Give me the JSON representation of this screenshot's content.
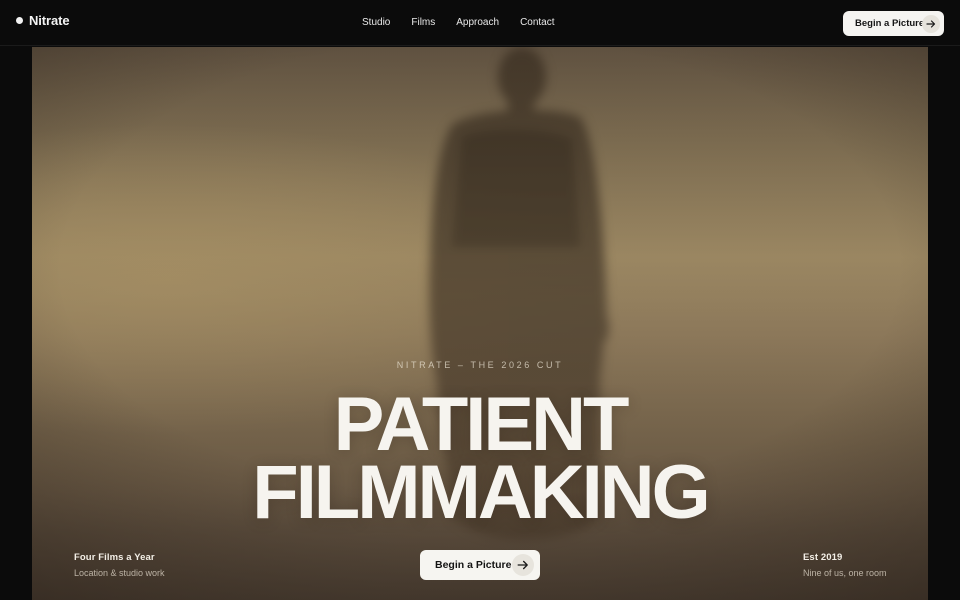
{
  "brand": {
    "name": "Nitrate",
    "dot_icon": "circle-dot-icon"
  },
  "nav": {
    "items": [
      {
        "label": "Studio"
      },
      {
        "label": "Films"
      },
      {
        "label": "Approach"
      },
      {
        "label": "Contact"
      }
    ]
  },
  "header_cta": {
    "label": "Begin a Picture",
    "icon": "arrow-right-icon"
  },
  "hero": {
    "eyebrow": "NITRATE – THE 2026 CUT",
    "headline_line1": "PATIENT",
    "headline_line2": "FILMMAKING",
    "cta": {
      "label": "Begin a Picture",
      "icon": "arrow-right-icon"
    },
    "left_meta": {
      "title": "Four Films a Year",
      "subtitle": "Location & studio work"
    },
    "right_meta": {
      "title": "Est 2019",
      "subtitle": "Nine of us, one room"
    }
  },
  "colors": {
    "page_bg": "#0b0b0b",
    "button_bg": "#f5f4f1",
    "hero_tone": "#8c785a",
    "text_light": "#f6f4ef"
  }
}
